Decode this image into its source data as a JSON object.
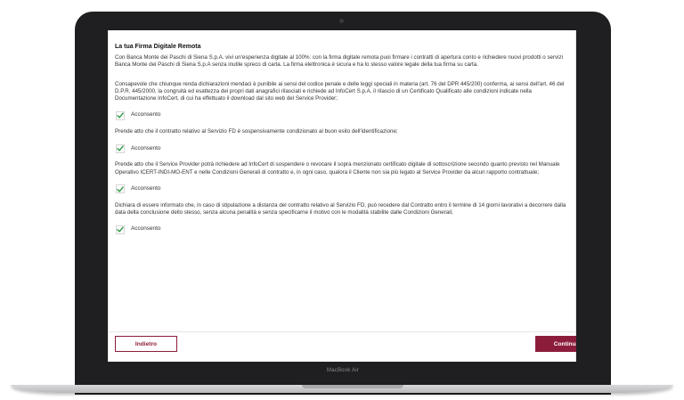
{
  "device": {
    "label": "MacBook Air"
  },
  "section": {
    "title": "La tua Firma Digitale Remota",
    "intro": "Con Banca Monte dei Paschi di Siena S.p.A. vivi un'esperienza digitale al 100%: con la firma digitale remota puoi firmare i contratti di apertura conto e richiedere nuovi prodotti o servizi Banca Monte dei Paschi di Siena S.p.A senza inutile spreco di carta. La firma elettronica è sicura e ha lo stesso valore legale della tua firma su carta."
  },
  "consents": [
    {
      "text": "Consapevole che chiunque renda dichiarazioni mendaci è punibile ai sensi del codice penale e delle leggi speciali in materia (art. 76 del DPR 445/200) conferma, ai sensi dell'art. 46 del D.P.R. 445/2000, la congruità ed esattezza dei propri dati anagrafici rilasciati e richiede ad InfoCert S.p.A. il rilascio di un Certificato Qualificato alle condizioni indicate nella Documentazione InfoCert, di cui ha effettuato il download dal sito web del Service Provider;",
      "label": "Acconsento",
      "checked": true
    },
    {
      "text": "Prende atto che il contratto relativo al Servizio FD è sospensivamente condizionato al buon esito dell'identificazione;",
      "label": "Acconsento",
      "checked": true
    },
    {
      "text": "Prende atto che il Service Provider potrà richiedere ad InfoCert di sospendere o revocare il sopra menzionato certificato digitale di sottoscrizione secondo quanto previsto nel Manuale Operativo ICERT-INDI-MO-ENT e nelle Condizioni Generali di contratto e, in ogni caso, qualora il Cliente non sia più legato al Service Provider da alcun rapporto contrattuale;",
      "label": "Acconsento",
      "checked": true
    },
    {
      "text": "Dichiara di essere informato che, in caso di stipulazione a distanza del contratto relativo al Servizio FD, può recedere dal Contratto entro il termine di 14 giorni lavorativi a decorrere dalla data della conclusione dello stesso, senza alcuna penalità e senza specificarne il motivo con le modalità stabilite dalle Condizioni Generali;",
      "label": "Acconsento",
      "checked": true
    }
  ],
  "footer": {
    "back_label": "Indietro",
    "next_label": "Continua"
  },
  "colors": {
    "brand": "#8c1d3a",
    "check": "#2e9b46"
  }
}
